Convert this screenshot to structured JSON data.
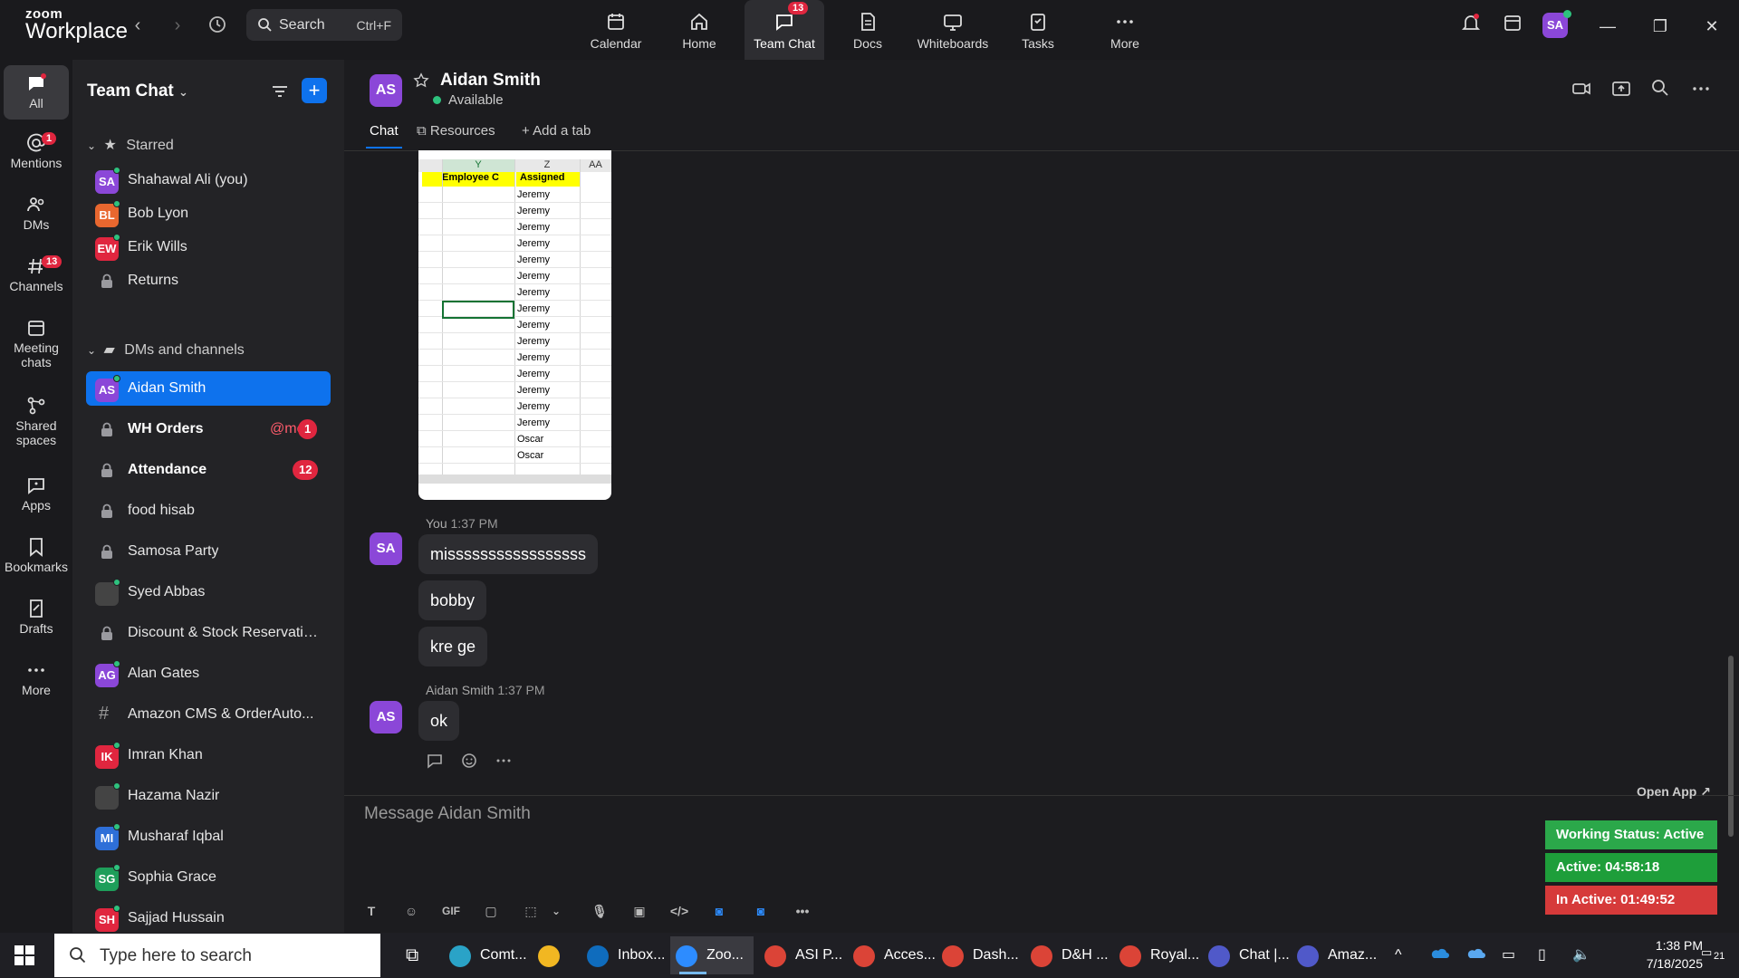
{
  "app": {
    "logo_line1": "zoom",
    "logo_line2": "Workplace",
    "search_label": "Search",
    "search_shortcut": "Ctrl+F"
  },
  "topnav": [
    {
      "label": "Calendar",
      "icon": "calendar-icon"
    },
    {
      "label": "Home",
      "icon": "home-icon"
    },
    {
      "label": "Team Chat",
      "icon": "chat-icon",
      "badge": "13",
      "active": true
    },
    {
      "label": "Docs",
      "icon": "docs-icon"
    },
    {
      "label": "Whiteboards",
      "icon": "whiteboard-icon"
    },
    {
      "label": "Tasks",
      "icon": "tasks-icon"
    },
    {
      "label": "More",
      "icon": "more-icon"
    }
  ],
  "user_avatar": "SA",
  "rail": [
    {
      "label": "All",
      "active": true
    },
    {
      "label": "Mentions",
      "badge": "1"
    },
    {
      "label": "DMs"
    },
    {
      "label": "Channels",
      "badge": "13"
    },
    {
      "label": "Meeting chats"
    },
    {
      "label": "Shared spaces"
    },
    {
      "label": "Apps"
    },
    {
      "label": "Bookmarks"
    },
    {
      "label": "Drafts"
    },
    {
      "label": "More"
    }
  ],
  "sidebar": {
    "title": "Team Chat",
    "starred_label": "Starred",
    "dms_label": "DMs and channels",
    "starred": [
      {
        "initials": "SA",
        "name": "Shahawal Ali (you)",
        "color": "#8b47d8"
      },
      {
        "initials": "BL",
        "name": "Bob Lyon",
        "color": "#e8672f"
      },
      {
        "initials": "EW",
        "name": "Erik Wills",
        "color": "#e0263f"
      },
      {
        "name": "Returns",
        "type": "lock"
      }
    ],
    "items": [
      {
        "initials": "AS",
        "name": "Aidan Smith",
        "color": "#8b47d8",
        "selected": true
      },
      {
        "name": "WH Orders",
        "type": "lock",
        "bold": true,
        "mention": "@me",
        "badge": "1"
      },
      {
        "name": "Attendance",
        "type": "lock",
        "bold": true,
        "badge": "12"
      },
      {
        "name": "food hisab",
        "type": "lock"
      },
      {
        "name": "Samosa Party",
        "type": "lock"
      },
      {
        "name": "Syed Abbas",
        "type": "photo"
      },
      {
        "name": "Discount & Stock Reservatio...",
        "type": "lock"
      },
      {
        "initials": "AG",
        "name": "Alan Gates",
        "color": "#8b47d8"
      },
      {
        "name": "Amazon CMS & OrderAuto...",
        "type": "hash"
      },
      {
        "initials": "IK",
        "name": "Imran Khan",
        "color": "#e0263f"
      },
      {
        "name": "Hazama Nazir",
        "type": "photo"
      },
      {
        "initials": "MI",
        "name": "Musharaf Iqbal",
        "color": "#2e6fd8"
      },
      {
        "initials": "SG",
        "name": "Sophia Grace",
        "color": "#1e9e5a"
      },
      {
        "initials": "SH",
        "name": "Sajjad Hussain",
        "color": "#e0263f"
      }
    ]
  },
  "chat": {
    "contact_initials": "AS",
    "contact_name": "Aidan Smith",
    "contact_status": "Available",
    "tabs": [
      "Chat",
      "Resources",
      "Add a tab"
    ],
    "sheet": {
      "col_y": "Y",
      "col_z": "Z",
      "col_aa": "AA",
      "hdr_y": "Employee C",
      "hdr_z": "Assigned",
      "rows": [
        "Jeremy",
        "Jeremy",
        "Jeremy",
        "Jeremy",
        "Jeremy",
        "Jeremy",
        "Jeremy",
        "Jeremy",
        "Jeremy",
        "Jeremy",
        "Jeremy",
        "Jeremy",
        "Jeremy",
        "Jeremy",
        "Jeremy",
        "Oscar",
        "Oscar"
      ]
    },
    "my_meta_who": "You",
    "my_meta_time": "1:37 PM",
    "my_initials": "SA",
    "my_messages": [
      "misssssssssssssssss",
      "bobby",
      "kre ge"
    ],
    "their_meta_who": "Aidan Smith",
    "their_meta_time": "1:37 PM",
    "their_messages": [
      "ok"
    ],
    "composer_placeholder": "Message Aidan Smith",
    "gif_label": "GIF"
  },
  "working_status": {
    "open_app": "Open App ↗",
    "status": "Working Status: Active",
    "active": "Active: 04:58:18",
    "inactive": "In Active: 01:49:52",
    "status_color": "#2ba84a",
    "active_color": "#1e9e3a",
    "inactive_color": "#d63a3a"
  },
  "taskbar": {
    "search_placeholder": "Type here to search",
    "apps": [
      {
        "label": "Comt...",
        "color": "#2aa3c7"
      },
      {
        "label": "",
        "color": "#f1b722"
      },
      {
        "label": "Inbox...",
        "color": "#0f6cbd"
      },
      {
        "label": "Zoo...",
        "color": "#2d8cff",
        "active": true
      },
      {
        "label": "ASI P...",
        "color": "#db4437"
      },
      {
        "label": "Acces...",
        "color": "#db4437"
      },
      {
        "label": "Dash...",
        "color": "#db4437"
      },
      {
        "label": "D&H ...",
        "color": "#db4437"
      },
      {
        "label": "Royal...",
        "color": "#db4437"
      },
      {
        "label": "Chat |...",
        "color": "#5059c9"
      },
      {
        "label": "Amaz...",
        "color": "#5059c9"
      }
    ],
    "time": "1:38 PM",
    "date": "7/18/2025",
    "notif_count": "21"
  }
}
